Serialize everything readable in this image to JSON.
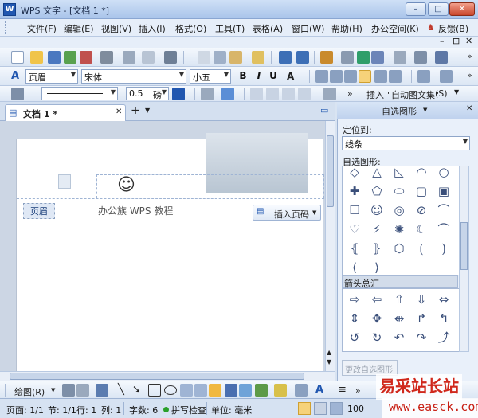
{
  "title": {
    "app_logo": "W",
    "text": "WPS 文字 - [文档 1 *]"
  },
  "window_controls": {
    "minimize": "–",
    "maximize": "□",
    "close": "✕"
  },
  "menu": {
    "items": [
      "文件(F)",
      "编辑(E)",
      "视图(V)",
      "插入(I)",
      "格式(O)",
      "工具(T)",
      "表格(A)",
      "窗口(W)",
      "帮助(H)",
      "办公空间(K)"
    ],
    "feedback": "反馈(B)",
    "more": "»",
    "mdi_controls": [
      "–",
      "⊡",
      "✕"
    ]
  },
  "format_bar": {
    "style": "页眉",
    "font": "宋体",
    "size": "小五",
    "bold": "B",
    "italic": "I",
    "underline": "U",
    "more": "»"
  },
  "drawing_props": {
    "line_width": "0.5",
    "unit": "磅",
    "insert_label": "插入",
    "autotext": "\"自动图文集\"",
    "shortcut": "(S)"
  },
  "tab": {
    "label": "文档 1 *",
    "close": "✕",
    "new_tab": "+"
  },
  "document": {
    "header_tag": "页眉",
    "header_text": "办公族 WPS 教程",
    "insert_page_number": "插入页码",
    "smiley": "☺"
  },
  "pane": {
    "title": "自选图形",
    "anchor_label": "定位到:",
    "anchor_value": "线条",
    "shapes_label": "自选图形:",
    "arrows_label": "箭头总汇",
    "change_button": "更改自选图形",
    "basic_shapes": [
      "◇",
      "△",
      "◺",
      "◠",
      "○",
      "□",
      "✚",
      "⬠",
      "⬭",
      "▣",
      "▢",
      "◫",
      "☐",
      "☺",
      "◎",
      "⊘",
      "⌒",
      "♡",
      "⚡",
      "✺",
      "☾",
      "⌒",
      "⦃",
      "⦄",
      "⬡",
      "⟮",
      "⟯",
      "⟨",
      "⟩"
    ],
    "arrows": [
      "⇨",
      "⇦",
      "⇧",
      "⇩",
      "⇔",
      "⇕",
      "✥",
      "⇹",
      "↱",
      "↰",
      "↺",
      "↻",
      "↶",
      "↷",
      "⤴",
      "⤵",
      "⇨",
      "⇦",
      "⇧",
      "⇩"
    ]
  },
  "drawbar": {
    "draw_label": "绘图(R)",
    "more": "»"
  },
  "status": {
    "page": "页面: 1/1",
    "section": "节: 1/1",
    "line": "行: 1",
    "column": "列: 1",
    "words": "字数: 6",
    "spell": "拼写检查",
    "unit": "单位: 毫米",
    "zoom": "100"
  },
  "watermark": {
    "text": "易采站长站",
    "url": "www.easck.com"
  },
  "colors": {
    "accent": "#2157b0",
    "spell_ok": "#2aa02a",
    "watermark": "#d0281c"
  }
}
